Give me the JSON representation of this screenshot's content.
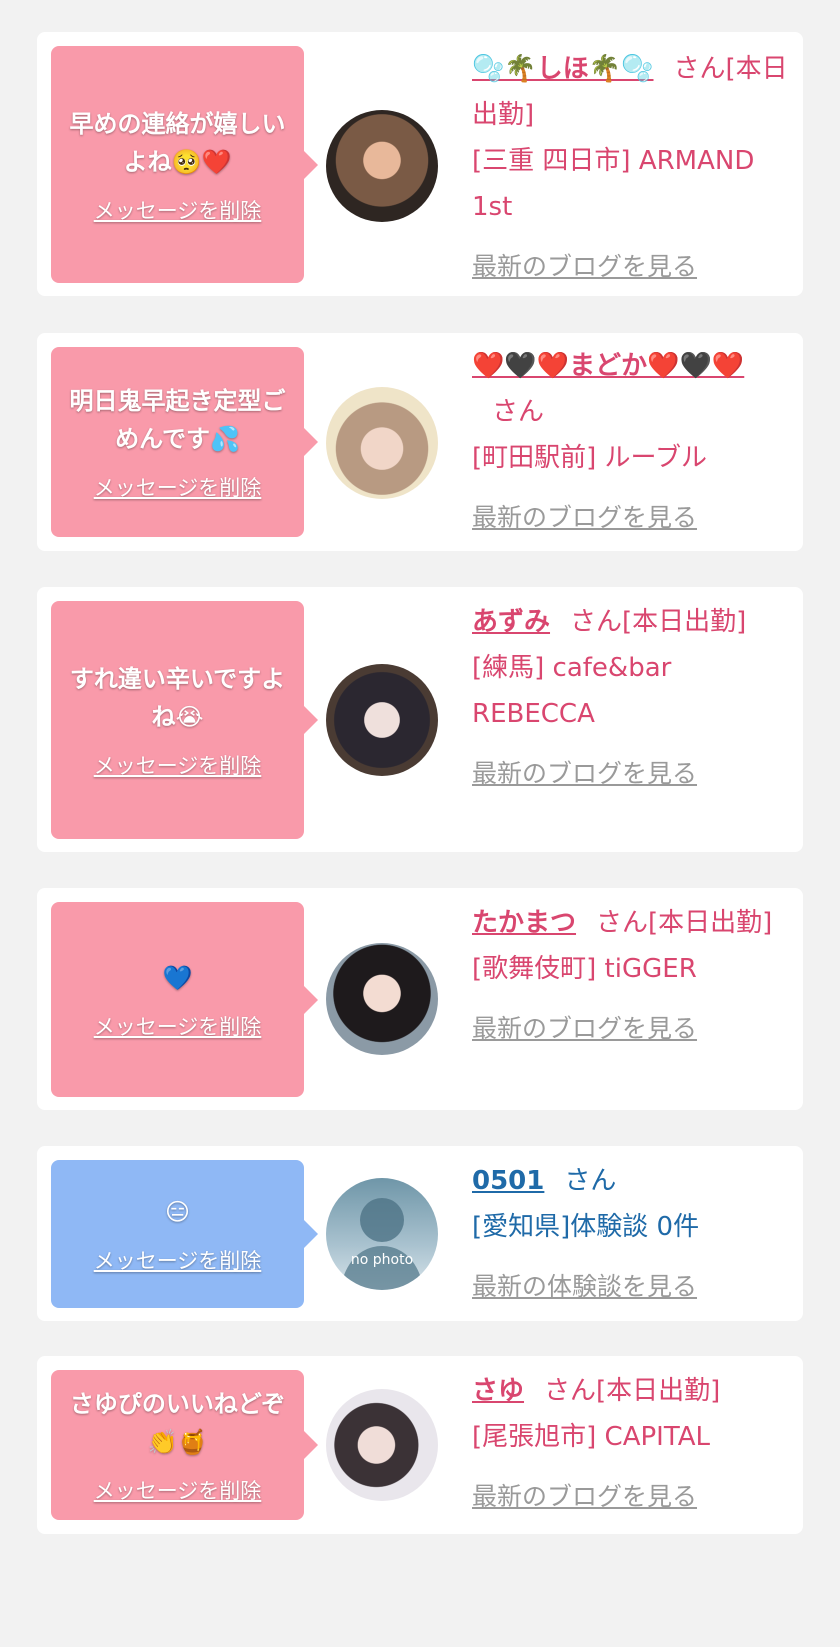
{
  "delete_label": "メッセージを削除",
  "colors": {
    "pink_bubble": "#f99aaa",
    "blue_bubble": "#8fb8f5",
    "name_pink": "#d9466f",
    "name_blue": "#1f6aa8",
    "link_gray": "#9a9a9a"
  },
  "items": [
    {
      "message": "早めの連絡が嬉しいよね🥺❤️",
      "name": "🫧🌴しほ🌴🫧",
      "suffix": "さん[本日出勤]",
      "detail": "[三重 四日市] ARMAND 1st",
      "link": "最新のブログを見る"
    },
    {
      "message": "明日鬼早起き定型ごめんです💦",
      "name": "❤️🖤❤️まどか❤️🖤❤️",
      "suffix": "さん",
      "detail": "[町田駅前] ルーブル",
      "link": "最新のブログを見る"
    },
    {
      "message": "すれ違い辛いですよね😭",
      "name": "あずみ",
      "suffix": "さん[本日出勤]",
      "detail": "[練馬] cafe&bar REBECCA",
      "link": "最新のブログを見る"
    },
    {
      "message": "💙",
      "name": "たかまつ",
      "suffix": "さん[本日出勤]",
      "detail": "[歌舞伎町] tiGGER",
      "link": "最新のブログを見る"
    },
    {
      "message": "😑",
      "name": "0501",
      "suffix": "さん",
      "detail": "[愛知県]体験談 0件",
      "link": "最新の体験談を見る",
      "avatar_text": "no photo"
    },
    {
      "message": "さゆぴのいいねどぞ👏🍯",
      "name": "さゆ",
      "suffix": "さん[本日出勤]",
      "detail": "[尾張旭市] CAPITAL",
      "link": "最新のブログを見る"
    }
  ]
}
